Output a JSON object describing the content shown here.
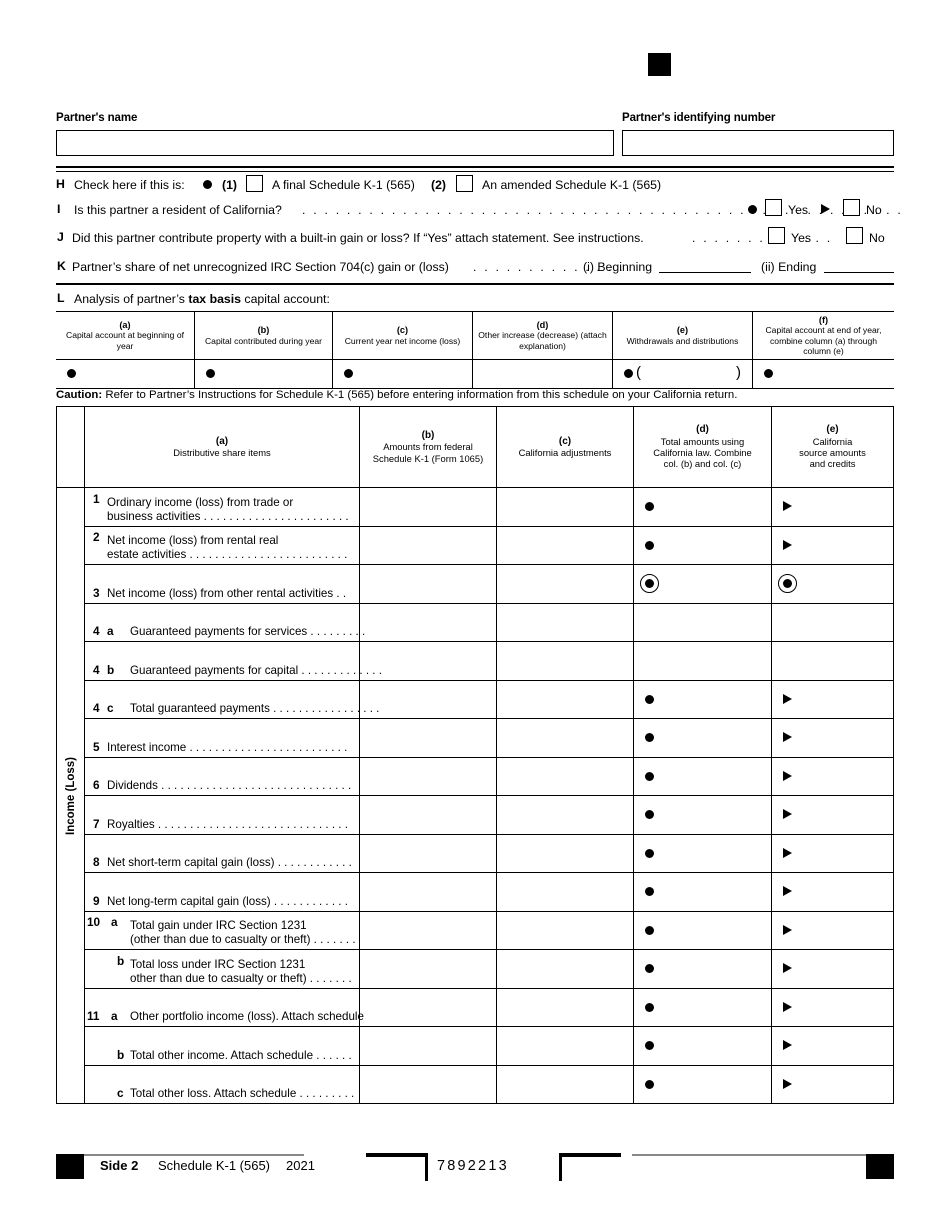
{
  "form": {
    "title": "Schedule K-1 (565) Side 2",
    "side_label": "Side 2",
    "form_name": "Schedule K-1 (565)",
    "year": "2021",
    "barcode_number": "7892213"
  },
  "header": {
    "partner_name_label": "Partner's name",
    "partner_id_label": "Partner's identifying number",
    "partner_name_value": "",
    "partner_id_value": ""
  },
  "questions": {
    "h": {
      "letter": "H",
      "text": "Check here if this is:",
      "opt1_num": "(1)",
      "opt1_text": "A final Schedule K-1 (565)",
      "opt2_num": "(2)",
      "opt2_text": "An amended Schedule K-1 (565)"
    },
    "i": {
      "letter": "I",
      "text": "Is this partner a resident of California?",
      "dots": ". . . . . . . . . . . . . . . . . . . . . . . . . . . . . . . . . . . . . . . . . . . . . . . . . . . . . .",
      "yes": "Yes",
      "no": "No"
    },
    "j": {
      "letter": "J",
      "text": "Did this partner contribute property with a built-in gain or loss? If “Yes” attach statement. See instructions.",
      "dots": ". . . . . . . . . . . . .",
      "yes": "Yes",
      "no": "No"
    },
    "k": {
      "letter": "K",
      "text": "Partner’s share of net unrecognized IRC Section 704(c) gain or (loss)",
      "dots": ". . . . . . . . . . . . . .",
      "beginning_label": "(i) Beginning",
      "ending_label": "(ii) Ending",
      "beginning_value": "",
      "ending_value": ""
    },
    "l": {
      "letter": "L",
      "text_pre": "Analysis of partner’s ",
      "text_bold": "tax basis",
      "text_post": " capital account:"
    }
  },
  "capital_table": {
    "columns": [
      {
        "key": "(a)",
        "label": "Capital account at beginning of year",
        "value": "",
        "marker": "bullet"
      },
      {
        "key": "(b)",
        "label": "Capital contributed during year",
        "value": "",
        "marker": "bullet"
      },
      {
        "key": "(c)",
        "label": "Current year net income (loss)",
        "value": "",
        "marker": "bullet"
      },
      {
        "key": "(d)",
        "label": "Other increase (decrease) (attach explanation)",
        "value": "",
        "marker": "none"
      },
      {
        "key": "(e)",
        "label": "Withdrawals and distributions",
        "value": "",
        "marker": "bullet-paren"
      },
      {
        "key": "(f)",
        "label": "Capital account at end of year, combine column (a) through column (e)",
        "value": "",
        "marker": "bullet"
      }
    ],
    "paren_open": "(",
    "paren_close": ")"
  },
  "caution": {
    "bold": "Caution:",
    "text": " Refer to Partner’s Instructions for Schedule K-1 (565) before entering information from this schedule on your California return."
  },
  "main_table": {
    "spine_label": "Income (Loss)",
    "headers": [
      {
        "key": "(a)",
        "lines": [
          "Distributive share items"
        ]
      },
      {
        "key": "(b)",
        "lines": [
          "Amounts from federal",
          "Schedule K-1 (Form 1065)"
        ]
      },
      {
        "key": "(c)",
        "lines": [
          "California adjustments"
        ]
      },
      {
        "key": "(d)",
        "lines": [
          "Total amounts using",
          "California law. Combine",
          "col. (b) and col. (c)"
        ]
      },
      {
        "key": "(e)",
        "lines": [
          "California",
          "source amounts",
          "and credits"
        ]
      }
    ],
    "rows": [
      {
        "num": "1",
        "sub": "",
        "lines": [
          "Ordinary income (loss) from trade or",
          "business activities . . . . . . . . . . . . . . . . . . . . . . ."
        ],
        "b": "",
        "c": "",
        "d_mark": "bullet",
        "e_mark": "triangle"
      },
      {
        "num": "2",
        "sub": "",
        "lines": [
          "Net income (loss) from rental real",
          "estate activities . . . . . . . . . . . . . . . . . . . . . . . . ."
        ],
        "b": "",
        "c": "",
        "d_mark": "bullet",
        "e_mark": "triangle"
      },
      {
        "num": "3",
        "sub": "",
        "lines": [
          "Net income (loss) from other rental activities  . ."
        ],
        "b": "",
        "c": "",
        "d_mark": "ring-bullet",
        "e_mark": "ring-bullet"
      },
      {
        "num": "4",
        "sub": "a",
        "lines": [
          "Guaranteed payments for services  . . . . . . . . ."
        ],
        "b": "",
        "c": "",
        "d_mark": "none",
        "e_mark": "none"
      },
      {
        "num": "4",
        "sub": "b",
        "lines": [
          "Guaranteed payments for capital . . . . . . . . . . . . ."
        ],
        "b": "",
        "c": "",
        "d_mark": "none",
        "e_mark": "none"
      },
      {
        "num": "4",
        "sub": "c",
        "lines": [
          "Total guaranteed payments . . . . . . . . . . . . . . . . ."
        ],
        "b": "",
        "c": "",
        "d_mark": "bullet",
        "e_mark": "triangle"
      },
      {
        "num": "5",
        "sub": "",
        "lines": [
          "Interest income  . . . . . . . . . . . . . . . . . . . . . . . . ."
        ],
        "b": "",
        "c": "",
        "d_mark": "bullet",
        "e_mark": "triangle"
      },
      {
        "num": "6",
        "sub": "",
        "lines": [
          "Dividends . . . . . . . . . . . . . . . . . . . . . . . . . . . . . ."
        ],
        "b": "",
        "c": "",
        "d_mark": "bullet",
        "e_mark": "triangle"
      },
      {
        "num": "7",
        "sub": "",
        "lines": [
          "Royalties  . . . . . . . . . . . . . . . . . . . . . . . . . . . . . ."
        ],
        "b": "",
        "c": "",
        "d_mark": "bullet",
        "e_mark": "triangle"
      },
      {
        "num": "8",
        "sub": "",
        "lines": [
          "Net short-term capital gain (loss) . . . . . . . . . . . ."
        ],
        "b": "",
        "c": "",
        "d_mark": "bullet",
        "e_mark": "triangle"
      },
      {
        "num": "9",
        "sub": "",
        "lines": [
          "Net long-term capital gain (loss)  . . . . . . . . . . . ."
        ],
        "b": "",
        "c": "",
        "d_mark": "bullet",
        "e_mark": "triangle"
      },
      {
        "num": "10",
        "sub": "a",
        "lines": [
          "Total gain under IRC Section 1231",
          "(other than due to casualty or theft) . . . . . . ."
        ],
        "b": "",
        "c": "",
        "d_mark": "bullet",
        "e_mark": "triangle"
      },
      {
        "num": "",
        "sub": "b",
        "lines": [
          "Total loss under IRC Section 1231",
          "other than due to casualty or theft)  . . . . . . ."
        ],
        "b": "",
        "c": "",
        "d_mark": "bullet",
        "e_mark": "triangle"
      },
      {
        "num": "11",
        "sub": "a",
        "lines": [
          "Other portfolio income (loss). Attach schedule"
        ],
        "b": "",
        "c": "",
        "d_mark": "bullet",
        "e_mark": "triangle"
      },
      {
        "num": "",
        "sub": "b",
        "lines": [
          "Total other income. Attach schedule  . . . . . ."
        ],
        "b": "",
        "c": "",
        "d_mark": "bullet",
        "e_mark": "triangle"
      },
      {
        "num": "",
        "sub": "c",
        "lines": [
          "Total other loss. Attach schedule  . . . . . . . . ."
        ],
        "b": "",
        "c": "",
        "d_mark": "bullet",
        "e_mark": "triangle"
      }
    ]
  }
}
